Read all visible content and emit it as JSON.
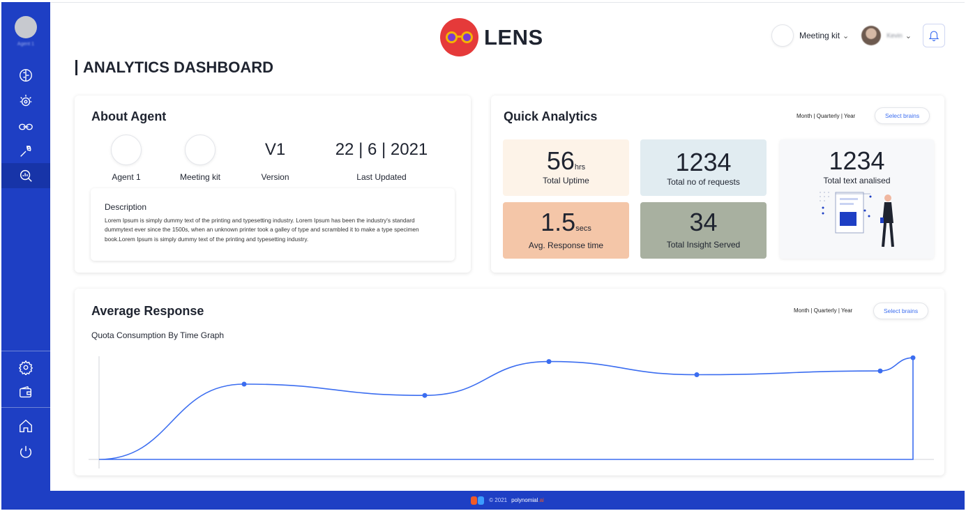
{
  "sidebar": {
    "user_name": "Agent 1",
    "icons": [
      "brain-icon",
      "bulb-icon",
      "link-icon",
      "wrench-icon",
      "analytics-icon",
      "settings-icon",
      "wallet-icon",
      "home-icon",
      "power-icon"
    ],
    "active": "analytics-icon"
  },
  "header": {
    "logo_text": "LENS",
    "kit_label": "Meeting kit",
    "user_name": "Kevin"
  },
  "page": {
    "title": "ANALYTICS DASHBOARD"
  },
  "about": {
    "title": "About Agent",
    "agent_label": "Agent 1",
    "kit_label": "Meeting kit",
    "version_value": "V1",
    "version_label": "Version",
    "updated_value": "22 | 6 | 2021",
    "updated_label": "Last Updated",
    "description_heading": "Description",
    "description_text": "Lorem Ipsum is simply dummy text of the printing and typesetting industry. Lorem Ipsum has been the industry's standard dummytext ever since the 1500s, when an unknown printer took a galley of type and scrambled it to make a type specimen book.Lorem Ipsum is simply dummy text of the printing and typesetting industry."
  },
  "quick": {
    "title": "Quick Analytics",
    "filter": "Month | Quarterly | Year",
    "select_label": "Select brains",
    "uptime_value": "56",
    "uptime_unit": "hrs",
    "uptime_label": "Total Uptime",
    "requests_value": "1234",
    "requests_label": "Total no of requests",
    "response_value": "1.5",
    "response_unit": "secs",
    "response_label": "Avg. Response time",
    "insight_value": "34",
    "insight_label": "Total Insight Served",
    "text_value": "1234",
    "text_label": "Total text analised"
  },
  "average": {
    "title": "Average Response",
    "subtitle": "Quota Consumption By Time Graph",
    "filter": "Month | Quarterly | Year",
    "select_label": "Select brains"
  },
  "chart_data": {
    "type": "line",
    "title": "Quota Consumption By Time Graph",
    "points": [
      0,
      0.4,
      0.34,
      0.52,
      0.45,
      0.47,
      0.54
    ],
    "color": "#3b6df0",
    "grid": false
  },
  "footer": {
    "copyright": "© 2021",
    "brand": "polynomial",
    "brand_suffix": ".ai"
  },
  "colors": {
    "sidebar": "#1e3fc4",
    "accent": "#3b6df0"
  }
}
